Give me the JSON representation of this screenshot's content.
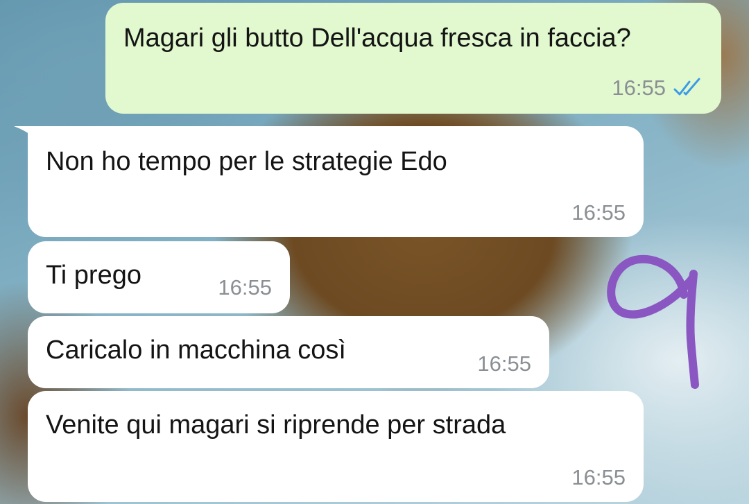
{
  "messages": [
    {
      "direction": "outgoing",
      "text": "Magari gli butto Dell'acqua fresca in faccia?",
      "time": "16:55",
      "status_icon": "double-check-read-icon"
    },
    {
      "direction": "incoming",
      "text": "Non ho tempo per le strategie Edo",
      "time": "16:55"
    },
    {
      "direction": "incoming",
      "text": "Ti prego",
      "time": "16:55"
    },
    {
      "direction": "incoming",
      "text": "Caricalo in macchina così",
      "time": "16:55"
    },
    {
      "direction": "incoming",
      "text": "Venite qui magari si riprende per strada",
      "time": "16:55"
    }
  ],
  "annotation": {
    "glyph": "9",
    "color": "#8a56c2"
  },
  "colors": {
    "outgoing_bubble": "#e2f9cf",
    "incoming_bubble": "#ffffff",
    "read_check": "#3a9be6",
    "timestamp": "#8a8f93"
  }
}
